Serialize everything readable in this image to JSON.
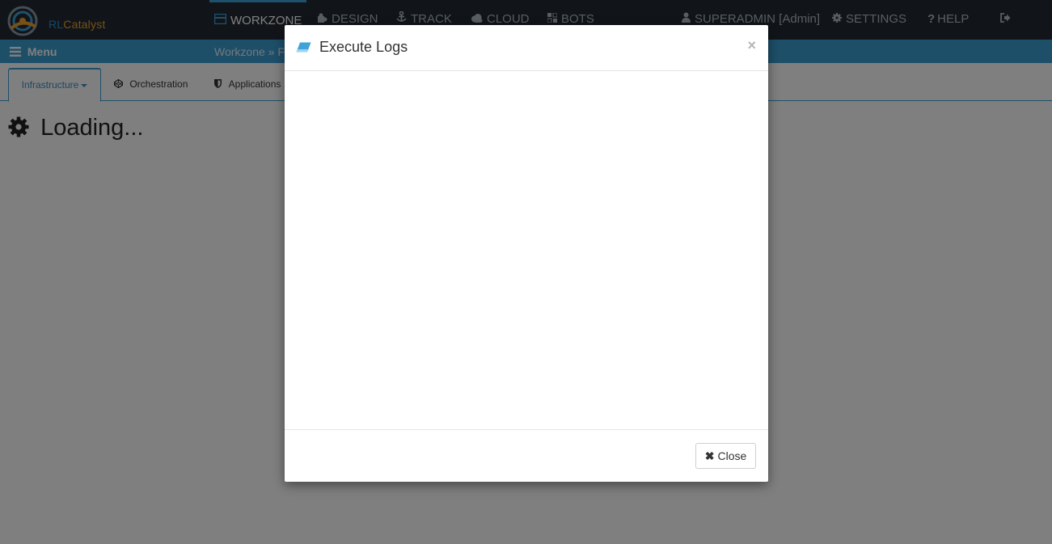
{
  "logo": {
    "text_prefix": "RL",
    "text_suffix": "Catalyst"
  },
  "topnav": {
    "items": [
      {
        "label": "WORKZONE",
        "icon": "workzone-icon"
      },
      {
        "label": "DESIGN",
        "icon": "puzzle-icon"
      },
      {
        "label": "TRACK",
        "icon": "anchor-icon"
      },
      {
        "label": "CLOUD",
        "icon": "cloud-icon"
      },
      {
        "label": "BOTS",
        "icon": "bots-icon"
      }
    ],
    "user": "SUPERADMIN [Admin]",
    "settings": "SETTINGS",
    "help": "HELP"
  },
  "subbar": {
    "menu_label": "Menu",
    "breadcrumb": "Workzone » F"
  },
  "tabs": [
    "Infrastructure",
    "Orchestration",
    "Applications"
  ],
  "main": {
    "loading_text": "Loading..."
  },
  "modal": {
    "title": "Execute Logs",
    "close_x": "×",
    "close_button": "Close"
  },
  "colors": {
    "topnav_bg": "#222b33",
    "accent": "#3b9ed2",
    "logo_orange": "#f0a030"
  }
}
